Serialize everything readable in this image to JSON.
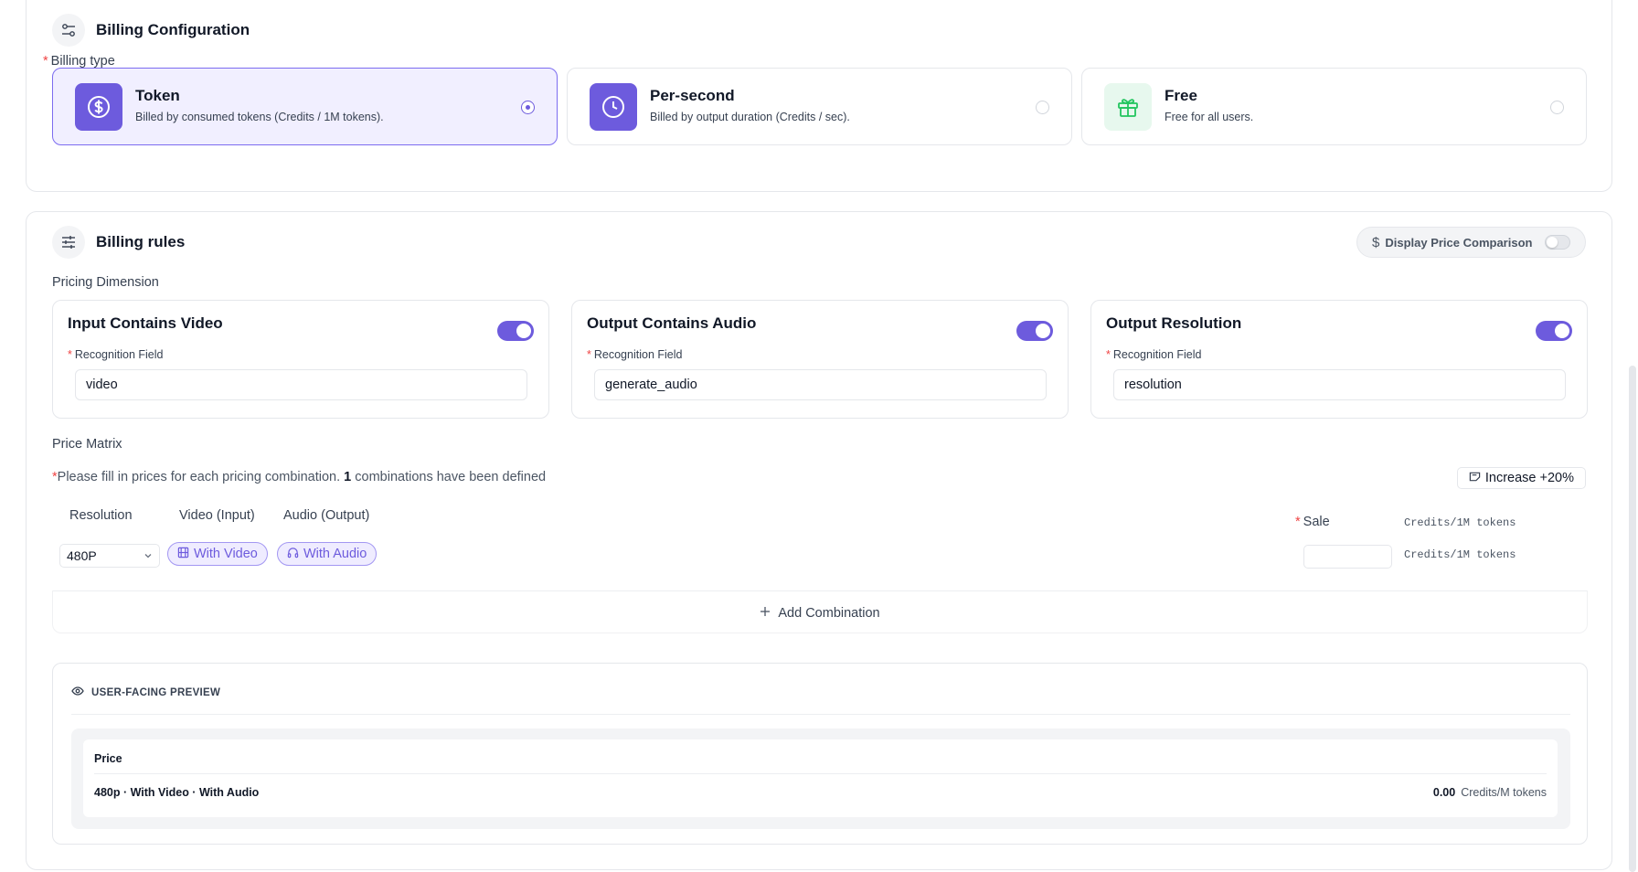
{
  "billing_config": {
    "title": "Billing Configuration",
    "billing_type_label": "Billing type",
    "options": [
      {
        "title": "Token",
        "description": "Billed by consumed tokens (Credits / 1M tokens).",
        "icon": "dollar-icon",
        "selected": true
      },
      {
        "title": "Per-second",
        "description": "Billed by output duration (Credits / sec).",
        "icon": "clock-icon",
        "selected": false
      },
      {
        "title": "Free",
        "description": "Free for all users.",
        "icon": "gift-icon",
        "selected": false
      }
    ]
  },
  "billing_rules": {
    "title": "Billing rules",
    "display_price_comparison": {
      "label": "Display Price Comparison",
      "enabled": false
    },
    "pricing_dimension_label": "Pricing Dimension",
    "dimensions": [
      {
        "title": "Input Contains Video",
        "enabled": true,
        "field_label": "Recognition Field",
        "field_value": "video"
      },
      {
        "title": "Output Contains Audio",
        "enabled": true,
        "field_label": "Recognition Field",
        "field_value": "generate_audio"
      },
      {
        "title": "Output Resolution",
        "enabled": true,
        "field_label": "Recognition Field",
        "field_value": "resolution"
      }
    ],
    "price_matrix": {
      "label": "Price Matrix",
      "note_prefix": "Please fill in prices for each pricing combination. ",
      "note_count": "1",
      "note_suffix": " combinations have been defined",
      "increase_label": "Increase +20%",
      "columns": {
        "resolution": "Resolution",
        "video": "Video (Input)",
        "audio": "Audio (Output)",
        "sale": "Sale",
        "unit": "Credits/1M tokens"
      },
      "row": {
        "resolution": "480P",
        "video_tag": "With Video",
        "audio_tag": "With Audio",
        "sale_value": "",
        "unit": "Credits/1M tokens"
      },
      "add_combination_label": "Add Combination"
    },
    "preview": {
      "title": "USER-FACING PREVIEW",
      "table_header": "Price",
      "row_label": "480p · With Video · With Audio",
      "row_price": "0.00",
      "row_unit": "Credits/M tokens"
    }
  },
  "colors": {
    "accent": "#6d5bdd",
    "accent_bg": "#f1efff",
    "required": "#ef4444",
    "free_green": "#22c55e"
  }
}
